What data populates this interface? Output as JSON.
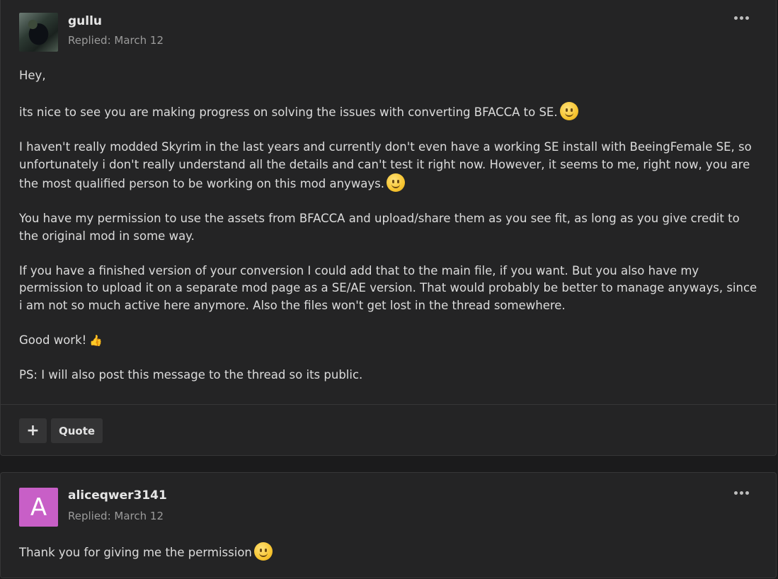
{
  "post1": {
    "author": "gullu",
    "meta": "Replied: March 12",
    "more_icon": "ellipsis-icon",
    "paragraphs": {
      "p1": "Hey,",
      "p2": "its nice to see you are making progress on solving the issues with converting BFACCA to SE.",
      "p3": "I haven't really modded Skyrim in the last years and currently don't even have a working SE install with BeeingFemale SE, so unfortunately i don't really understand all the details and can't test it right now. However, it seems to me, right now, you are the most qualified person to be working on this mod anyways.",
      "p4": "You have my permission to use the assets from BFACCA and upload/share them as you see fit, as long as you give credit to the original mod in some way.",
      "p5": "If you have a finished version of your conversion I could add that to the main file, if you want. But you also have my permission to upload it on a separate mod page as a SE/AE version. That would probably be better to manage anyways, since i am not so much active here anymore. Also the files won't get lost in the thread somewhere.",
      "p6": " Good work!",
      "p7": "PS: I will also post this message to the thread so its public."
    },
    "actions": {
      "plus_label": "+",
      "quote_label": "Quote"
    }
  },
  "post2": {
    "avatar_letter": "A",
    "author": "aliceqwer3141",
    "meta": "Replied: March 12",
    "more_icon": "ellipsis-icon",
    "paragraphs": {
      "p1": "Thank you for giving me the permission"
    }
  },
  "colors": {
    "page_bg": "#1b1b1c",
    "post_bg": "#242425",
    "avatar_letter_bg": "#c85fc7",
    "button_bg": "#343435"
  }
}
